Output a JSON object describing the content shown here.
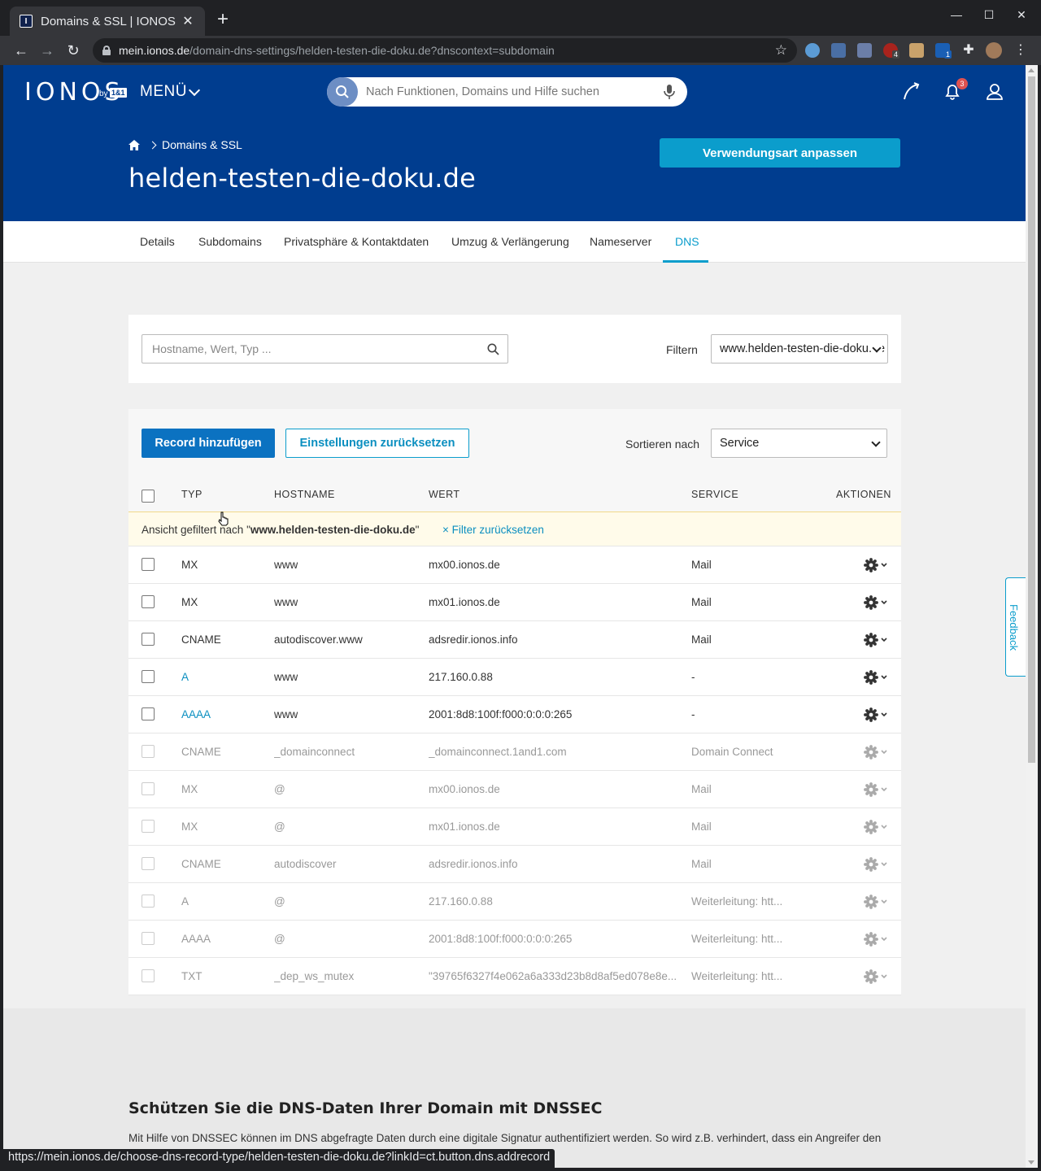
{
  "browser": {
    "tab_title": "Domains & SSL | IONOS",
    "url_host": "mein.ionos.de",
    "url_path": "/domain-dns-settings/helden-testen-die-doku.de?dnscontext=subdomain",
    "status_url": "https://mein.ionos.de/choose-dns-record-type/helden-testen-die-doku.de?linkId=ct.button.dns.addrecord",
    "ext_badges": [
      "4",
      "1"
    ]
  },
  "header": {
    "logo": "IONOS",
    "logo_by": "by",
    "logo_brand": "1&1",
    "menu_label": "MENÜ",
    "search_placeholder": "Nach Funktionen, Domains und Hilfe suchen",
    "notification_count": "3"
  },
  "hero": {
    "breadcrumb": "Domains & SSL",
    "title": "helden-testen-die-doku.de",
    "cta_label": "Verwendungsart anpassen"
  },
  "subnav": {
    "tabs": [
      "Details",
      "Subdomains",
      "Privatsphäre & Kontaktdaten",
      "Umzug & Verlängerung",
      "Nameserver",
      "DNS"
    ],
    "active": "DNS"
  },
  "filter": {
    "search_placeholder": "Hostname, Wert, Typ ...",
    "filter_label": "Filtern",
    "filter_value": "www.helden-testen-die-doku.de"
  },
  "toolbar": {
    "add_label": "Record hinzufügen",
    "reset_label": "Einstellungen zurücksetzen",
    "sort_label": "Sortieren nach",
    "sort_value": "Service"
  },
  "table": {
    "headers": {
      "type": "TYP",
      "hostname": "HOSTNAME",
      "value": "WERT",
      "service": "SERVICE",
      "actions": "AKTIONEN"
    },
    "notice_prefix": "Ansicht gefiltert nach \"",
    "notice_domain": "www.helden-testen-die-doku.de",
    "notice_suffix": "\"",
    "notice_reset": "× Filter zurücksetzen",
    "rows": [
      {
        "type": "MX",
        "hostname": "www",
        "value": "mx00.ionos.de",
        "service": "Mail",
        "dim": false,
        "link": false
      },
      {
        "type": "MX",
        "hostname": "www",
        "value": "mx01.ionos.de",
        "service": "Mail",
        "dim": false,
        "link": false
      },
      {
        "type": "CNAME",
        "hostname": "autodiscover.www",
        "value": "adsredir.ionos.info",
        "service": "Mail",
        "dim": false,
        "link": false
      },
      {
        "type": "A",
        "hostname": "www",
        "value": "217.160.0.88",
        "service": "-",
        "dim": false,
        "link": true
      },
      {
        "type": "AAAA",
        "hostname": "www",
        "value": "2001:8d8:100f:f000:0:0:0:265",
        "service": "-",
        "dim": false,
        "link": true
      },
      {
        "type": "CNAME",
        "hostname": "_domainconnect",
        "value": "_domainconnect.1and1.com",
        "service": "Domain Connect",
        "dim": true,
        "link": false
      },
      {
        "type": "MX",
        "hostname": "@",
        "value": "mx00.ionos.de",
        "service": "Mail",
        "dim": true,
        "link": false
      },
      {
        "type": "MX",
        "hostname": "@",
        "value": "mx01.ionos.de",
        "service": "Mail",
        "dim": true,
        "link": false
      },
      {
        "type": "CNAME",
        "hostname": "autodiscover",
        "value": "adsredir.ionos.info",
        "service": "Mail",
        "dim": true,
        "link": false
      },
      {
        "type": "A",
        "hostname": "@",
        "value": "217.160.0.88",
        "service": "Weiterleitung: htt...",
        "dim": true,
        "link": false
      },
      {
        "type": "AAAA",
        "hostname": "@",
        "value": "2001:8d8:100f:f000:0:0:0:265",
        "service": "Weiterleitung: htt...",
        "dim": true,
        "link": false
      },
      {
        "type": "TXT",
        "hostname": "_dep_ws_mutex",
        "value": "\"39765f6327f4e062a6a333d23b8d8af5ed078e8e...",
        "service": "Weiterleitung: htt...",
        "dim": true,
        "link": false
      }
    ]
  },
  "dnssec": {
    "title": "Schützen Sie die DNS-Daten Ihrer Domain mit DNSSEC",
    "text": "Mit Hilfe von DNSSEC können im DNS abgefragte Daten durch eine digitale Signatur authentifiziert werden. So wird z.B. verhindert, dass ein Angreifer den Datenverkehr auf eine manipulierte Seite umleiten kann."
  },
  "feedback_label": "Feedback",
  "colors": {
    "brand": "#003d8f",
    "accent": "#0b9dcc",
    "primary_button": "#0b72c1",
    "notice_bg": "#fffbea"
  }
}
